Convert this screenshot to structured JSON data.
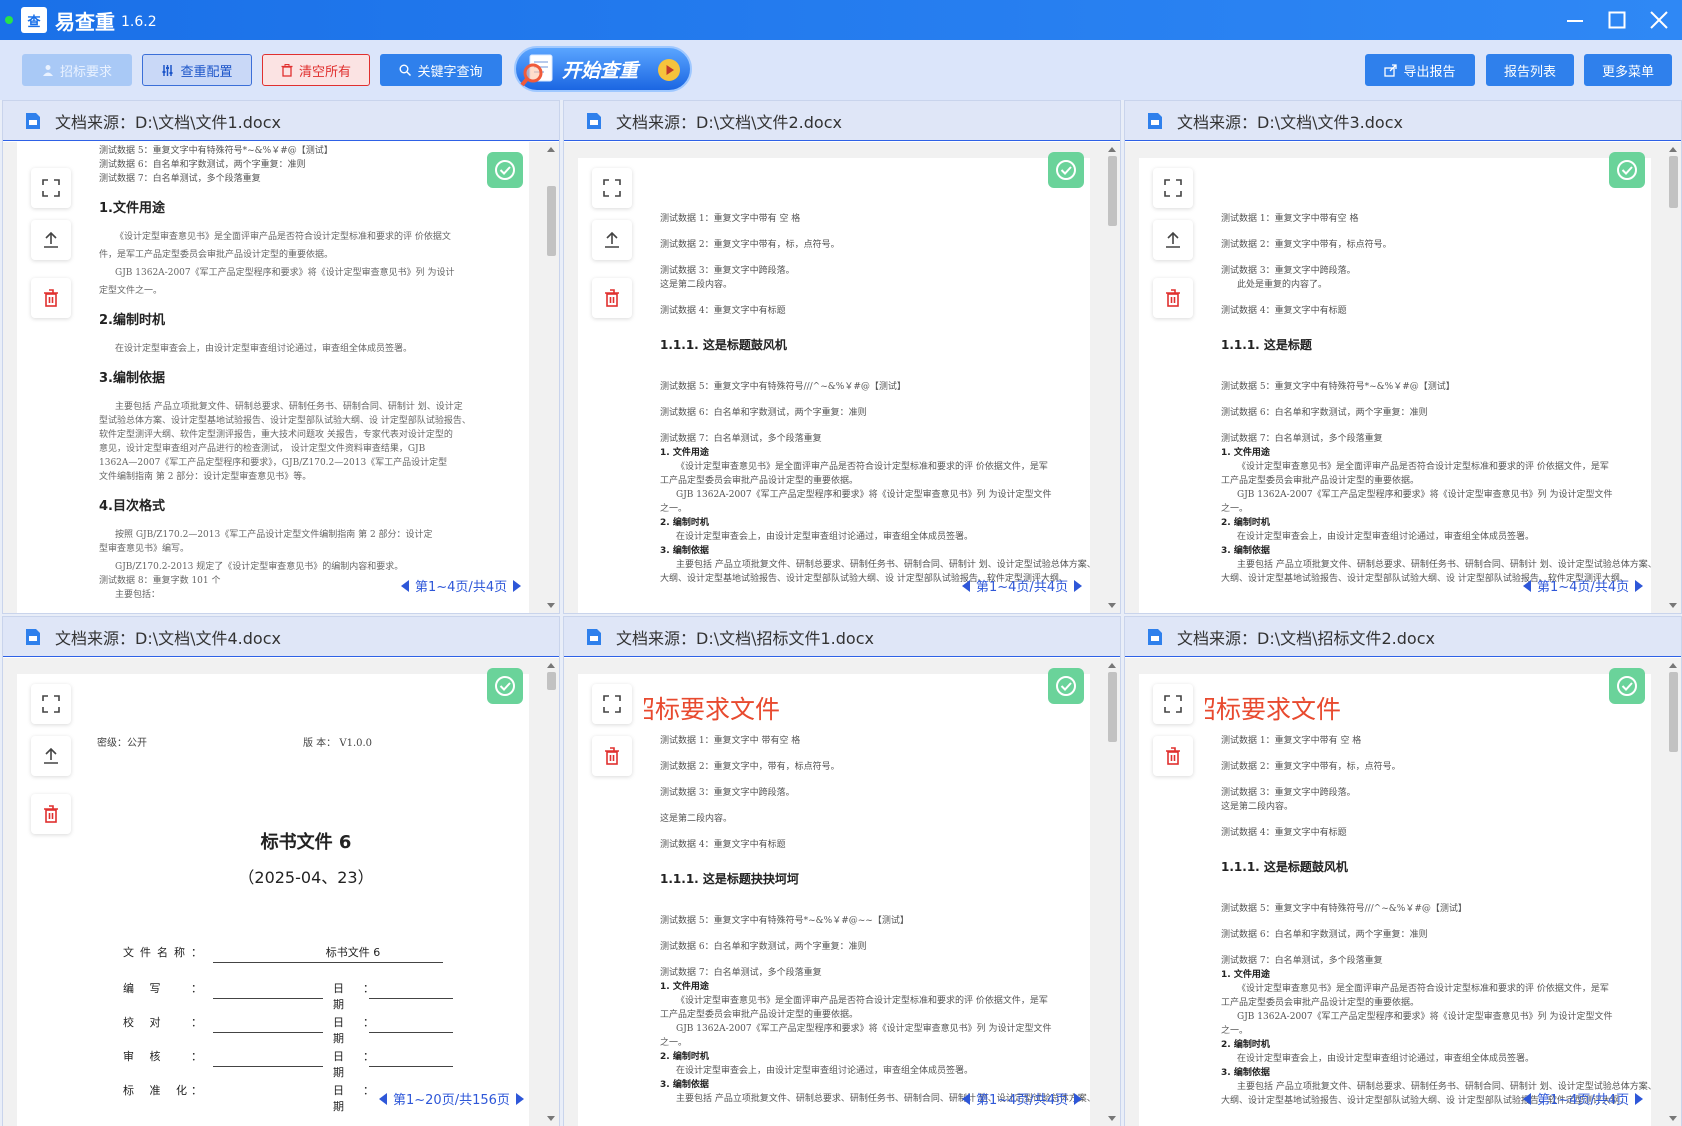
{
  "app": {
    "title": "易查重",
    "version": "1.6.2",
    "logo_text": "查"
  },
  "toolbar": {
    "tender_requirements": "招标要求",
    "check_config": "查重配置",
    "clear_all": "清空所有",
    "keyword_search": "关键字查询",
    "start_check": "开始查重",
    "export_report": "导出报告",
    "report_list": "报告列表",
    "more_menu": "更多菜单"
  },
  "colors": {
    "titlebar": "#1a70e8",
    "primary": "#2f80ec",
    "danger": "#e0302f",
    "success_badge": "#6ad39a",
    "red_heading": "#e84a2f"
  },
  "panels": [
    {
      "source": "文档来源：D:\\文档\\文件1.docx",
      "pager": "第1~4页/共4页",
      "content": {
        "top_lines": [
          "测试数据 5：重复文字中有特殊符号*~&%￥#@【测试】",
          "测试数据 6：自名单和字数测试，两个字重复：准则",
          "测试数据 7：白名单测试，多个段落重复"
        ],
        "s1_heading": "1.文件用途",
        "s1_lines": [
          "《设计定型审查意见书》是全面评审产品是否符合设计定型标准和要求的评  价依据文",
          "件，是军工产品定型委员会审批产品设计定型的重要依据。",
          "GJB   1362A-2007《军工产品定型程序和要求》将《设计定型审查意见书》列  为设计",
          "定型文件之一。"
        ],
        "s2_heading": "2.编制时机",
        "s2_lines": [
          "在设计定型审查会上，由设计定型审查组讨论通过，审查组全体成员签署。"
        ],
        "s3_heading": "3.编制依据",
        "s3_lines": [
          "主要包括  产品立项批复文件、研制总要求、研制任务书、研制合同、研制计  划、设计定",
          "型试验总体方案、设计定型基地试验报告、设计定型部队试验大纲、设  计定型部队试验报告、",
          "软件定型测评大纲、软件定型测评报告，重大技术问题攻  关报告，专家代表对设计定型的",
          "意见，设计定型审查组对产品进行的检查测试，  设计定型文件资料审查结果，GJB",
          "1362A—2007《军工产品定型程序和要求》，GJB/Z170.2—2013《军工产品设计定型",
          "文件编制指南  第 2 部分：设计定型审查意见书》等。"
        ],
        "s4_heading": "4.目次格式",
        "s4_lines": [
          "按照 GJB/Z170.2—2013《军工产品设计定型文件编制指南    第 2 部分：设计定",
          "型审查意见书》编写。",
          "GJB/Z170.2-2013    规定了《设计定型审查意见书》的编制内容和要求。",
          "测试数据 8：重复字数 101 个",
          "主要包括："
        ]
      }
    },
    {
      "source": "文档来源：D:\\文档\\文件2.docx",
      "pager": "第1~4页/共4页",
      "content": {
        "lines_a": [
          "测试数据 1：重复文字中带有  空  格",
          "测试数据 2：重复文字中带有，标，点符号。",
          "测试数据 3：重复文字中跨段落。",
          "这是第二段内容。",
          "测试数据 4：重复文字中有标题"
        ],
        "heading": "1.1.1. 这是标题鼓风机",
        "lines_b": [
          "测试数据 5：重复文字中有特殊符号///^~&%￥#@【测试】",
          "测试数据 6：白名单和字数测试，两个字重复：准则",
          "测试数据 7：白名单测试，多个段落重复"
        ],
        "sub1": "1. 文件用途",
        "sub1_lines": [
          "《设计定型审查意见书》是全面评审产品是否符合设计定型标准和要求的评  价依据文件，是军",
          "工产品定型委员会审批产品设计定型的重要依据。",
          "GJB    1362A-2007《军工产品定型程序和要求》将《设计定型审查意见书》列 为设计定型文件",
          "之一。"
        ],
        "sub2": "2. 编制时机",
        "sub2_lines": [
          "在设计定型审查会上，由设计定型审查组讨论通过，审查组全体成员签署。"
        ],
        "sub3": "3. 编制依据",
        "sub3_lines": [
          "主要包括  产品立项批复文件、研制总要求、研制任务书、研制合同、研制计  划、设计定型试验总体方案、",
          "大纲、设计定型基地试验报告、设计定型部队试验大纲、设  计定型部队试验报告、软件定型测评大纲、"
        ]
      }
    },
    {
      "source": "文档来源：D:\\文档\\文件3.docx",
      "pager": "第1~4页/共4页",
      "content": {
        "lines_a": [
          "测试数据 1：重复文字中带有空  格",
          "测试数据 2：重复文字中带有，标点符号。",
          "测试数据 3：重复文字中跨段落。",
          "此处是重复的内容了。",
          "测试数据 4：重复文字中有标题"
        ],
        "heading": "1.1.1. 这是标题",
        "lines_b": [
          "测试数据 5：重复文字中有特殊符号*~&%￥#@【测试】",
          "测试数据 6：白名单和字数测试，两个字重复：准则",
          "测试数据 7：白名单测试，多个段落重复"
        ],
        "sub1": "1. 文件用途",
        "sub1_lines": [
          "《设计定型审查意见书》是全面评审产品是否符合设计定型标准和要求的评  价依据文件，是军",
          "工产品定型委员会审批产品设计定型的重要依据。",
          "GJB    1362A-2007《军工产品定型程序和要求》将《设计定型审查意见书》列 为设计定型文件",
          "之一。"
        ],
        "sub2": "2. 编制时机",
        "sub2_lines": [
          "在设计定型审查会上，由设计定型审查组讨论通过，审查组全体成员签署。"
        ],
        "sub3": "3. 编制依据",
        "sub3_lines": [
          "主要包括  产品立项批复文件、研制总要求、研制任务书、研制合同、研制计  划、设计定型试验总体方案、",
          "大纲、设计定型基地试验报告、设计定型部队试验大纲、设  计定型部队试验报告、软件定型测评大纲、"
        ]
      }
    },
    {
      "source": "文档来源：D:\\文档\\文件4.docx",
      "pager": "第1~20页/共156页",
      "content": {
        "secret": "密级：公开",
        "version": "版      本：  V1.0.0",
        "title": "标书文件 6",
        "date": "（2025-04、23）",
        "form": {
          "name_label": "文件名称",
          "name_value": "标书文件 6",
          "rows": [
            "编    写",
            "校    对",
            "审    核",
            "标 准 化"
          ],
          "date_label": "日期",
          "colon": "："
        }
      }
    },
    {
      "source": "文档来源：D:\\文档\\招标文件1.docx",
      "pager": "第1~4页/共4页",
      "content": {
        "red_title": "招标要求文件",
        "lines_a": [
          "测试数据 1：重复文字中  带有空  格",
          "测试数据 2：重复文字中，带有，标点符号。",
          "测试数据 3：重复文字中跨段落。",
          "这是第二段内容。",
          "测试数据 4：重复文字中有标题"
        ],
        "heading": "1.1.1. 这是标题抉抉坷坷",
        "lines_b": [
          "测试数据 5：重复文字中有特殊符号*~&%￥#@~~【测试】",
          "测试数据 6：白名单和字数测试，两个字重复：准则",
          "测试数据 7：白名单测试，多个段落重复"
        ],
        "sub1": "1. 文件用途",
        "sub1_lines": [
          "《设计定型审查意见书》是全面评审产品是否符合设计定型标准和要求的评  价依据文件，是军",
          "工产品定型委员会审批产品设计定型的重要依据。",
          "GJB    1362A-2007《军工产品定型程序和要求》将《设计定型审查意见书》列 为设计定型文件",
          "之一。"
        ],
        "sub2": "2. 编制时机",
        "sub2_lines": [
          "在设计定型审查会上，由设计定型审查组讨论通过，审查组全体成员签署。"
        ],
        "sub3": "3. 编制依据",
        "sub3_lines": [
          "主要包括  产品立项批复文件、研制总要求、研制任务书、研制合同、研制计  划、设计定型试验总体方案、"
        ]
      }
    },
    {
      "source": "文档来源：D:\\文档\\招标文件2.docx",
      "pager": "第1~4页/共4页",
      "content": {
        "red_title": "招标要求文件",
        "lines_a": [
          "测试数据 1：重复文字中带有  空  格",
          "测试数据 2：重复文字中带有，标，点符号。",
          "测试数据 3：重复文字中跨段落。",
          "这是第二段内容。",
          "测试数据 4：重复文字中有标题"
        ],
        "heading": "1.1.1. 这是标题鼓风机",
        "lines_b": [
          "测试数据 5：重复文字中有特殊符号///^~&%￥#@【测试】",
          "测试数据 6：白名单和字数测试，两个字重复：准则",
          "测试数据 7：白名单测试，多个段落重复"
        ],
        "sub1": "1. 文件用途",
        "sub1_lines": [
          "《设计定型审查意见书》是全面评审产品是否符合设计定型标准和要求的评  价依据文件，是军",
          "工产品定型委员会审批产品设计定型的重要依据。",
          "GJB    1362A-2007《军工产品定型程序和要求》将《设计定型审查意见书》列 为设计定型文件",
          "之一。"
        ],
        "sub2": "2. 编制时机",
        "sub2_lines": [
          "在设计定型审查会上，由设计定型审查组讨论通过，审查组全体成员签署。"
        ],
        "sub3": "3. 编制依据",
        "sub3_lines": [
          "主要包括  产品立项批复文件、研制总要求、研制任务书、研制合同、研制计  划、设计定型试验总体方案、",
          "大纲、设计定型基地试验报告、设计定型部队试验大纲、设  计定型部队试验报告、软件定型测评大纲、"
        ]
      }
    }
  ]
}
